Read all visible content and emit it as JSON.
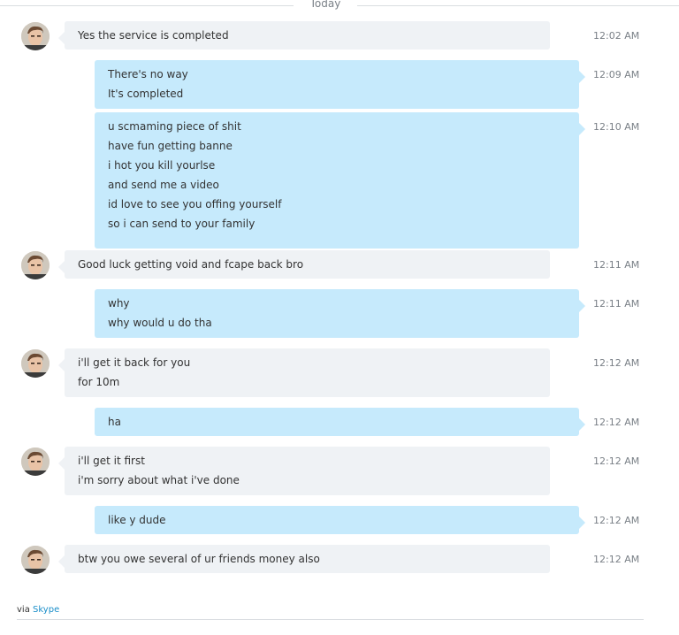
{
  "day_separator": "Today",
  "messages": [
    {
      "dir": "in",
      "time": "12:02 AM",
      "lines": [
        "Yes the service is completed"
      ]
    },
    {
      "dir": "out",
      "time": "12:09 AM",
      "lines": [
        "There's no way",
        "It's completed"
      ]
    },
    {
      "dir": "out",
      "time": "12:10 AM",
      "lines": [
        "u scmaming piece of shit",
        "have fun getting banne",
        "i hot you kill yourlse",
        "and send me a video",
        "id love to see you offing yourself",
        "so i can send to your family"
      ]
    },
    {
      "dir": "in",
      "time": "12:11 AM",
      "lines": [
        "Good luck getting void and fcape back bro"
      ]
    },
    {
      "dir": "out",
      "time": "12:11 AM",
      "lines": [
        "why",
        "why would u do tha"
      ]
    },
    {
      "dir": "in",
      "time": "12:12 AM",
      "lines": [
        "i'll get it back for you",
        "for 10m"
      ]
    },
    {
      "dir": "out",
      "time": "12:12 AM",
      "lines": [
        "ha"
      ]
    },
    {
      "dir": "in",
      "time": "12:12 AM",
      "lines": [
        "i'll get it first",
        "i'm sorry about what i've done"
      ]
    },
    {
      "dir": "out",
      "time": "12:12 AM",
      "lines": [
        "like y dude"
      ]
    },
    {
      "dir": "in",
      "time": "12:12 AM",
      "lines": [
        "btw you owe several of ur friends money also"
      ]
    }
  ],
  "footer": {
    "prefix": "via",
    "link": "Skype"
  },
  "colors": {
    "incoming_bubble": "#eff2f5",
    "outgoing_bubble": "#c6eafc",
    "link": "#1a8ec9"
  }
}
